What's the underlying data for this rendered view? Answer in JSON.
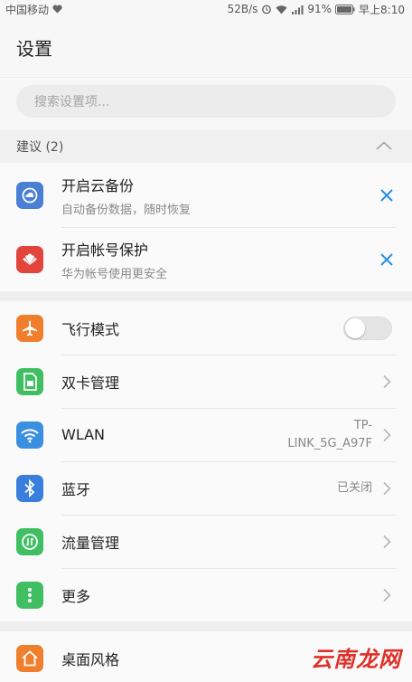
{
  "status_bar": {
    "carrier": "中国移动",
    "speed": "52B/s",
    "battery": "91%",
    "time": "早上8:10"
  },
  "header": {
    "title": "设置"
  },
  "search": {
    "placeholder": "搜索设置项..."
  },
  "suggestions": {
    "label": "建议 (2)",
    "items": [
      {
        "title": "开启云备份",
        "subtitle": "自动备份数据，随时恢复",
        "icon": "cloud-backup-icon",
        "color": "#4a7fd6"
      },
      {
        "title": "开启帐号保护",
        "subtitle": "华为帐号使用更安全",
        "icon": "huawei-icon",
        "color": "#e2453c"
      }
    ]
  },
  "settings": [
    {
      "label": "飞行模式",
      "icon": "airplane-icon",
      "color": "#f07f2d",
      "control": "toggle",
      "toggle_on": false
    },
    {
      "label": "双卡管理",
      "icon": "sim-card-icon",
      "color": "#3fbf62",
      "control": "chevron"
    },
    {
      "label": "WLAN",
      "icon": "wifi-icon",
      "color": "#3a8fe0",
      "value_line1": "TP-",
      "value_line2": "LINK_5G_A97F",
      "control": "chevron"
    },
    {
      "label": "蓝牙",
      "icon": "bluetooth-icon",
      "color": "#3a7fdc",
      "value": "已关闭",
      "control": "chevron"
    },
    {
      "label": "流量管理",
      "icon": "data-usage-icon",
      "color": "#3fbf62",
      "control": "chevron"
    },
    {
      "label": "更多",
      "icon": "more-icon",
      "color": "#3fbf62",
      "control": "chevron"
    }
  ],
  "settings2": [
    {
      "label": "桌面风格",
      "icon": "home-icon",
      "color": "#f07f2d",
      "control": "chevron"
    }
  ],
  "watermark": "云南龙网",
  "accent_color": "#2a8fe0"
}
